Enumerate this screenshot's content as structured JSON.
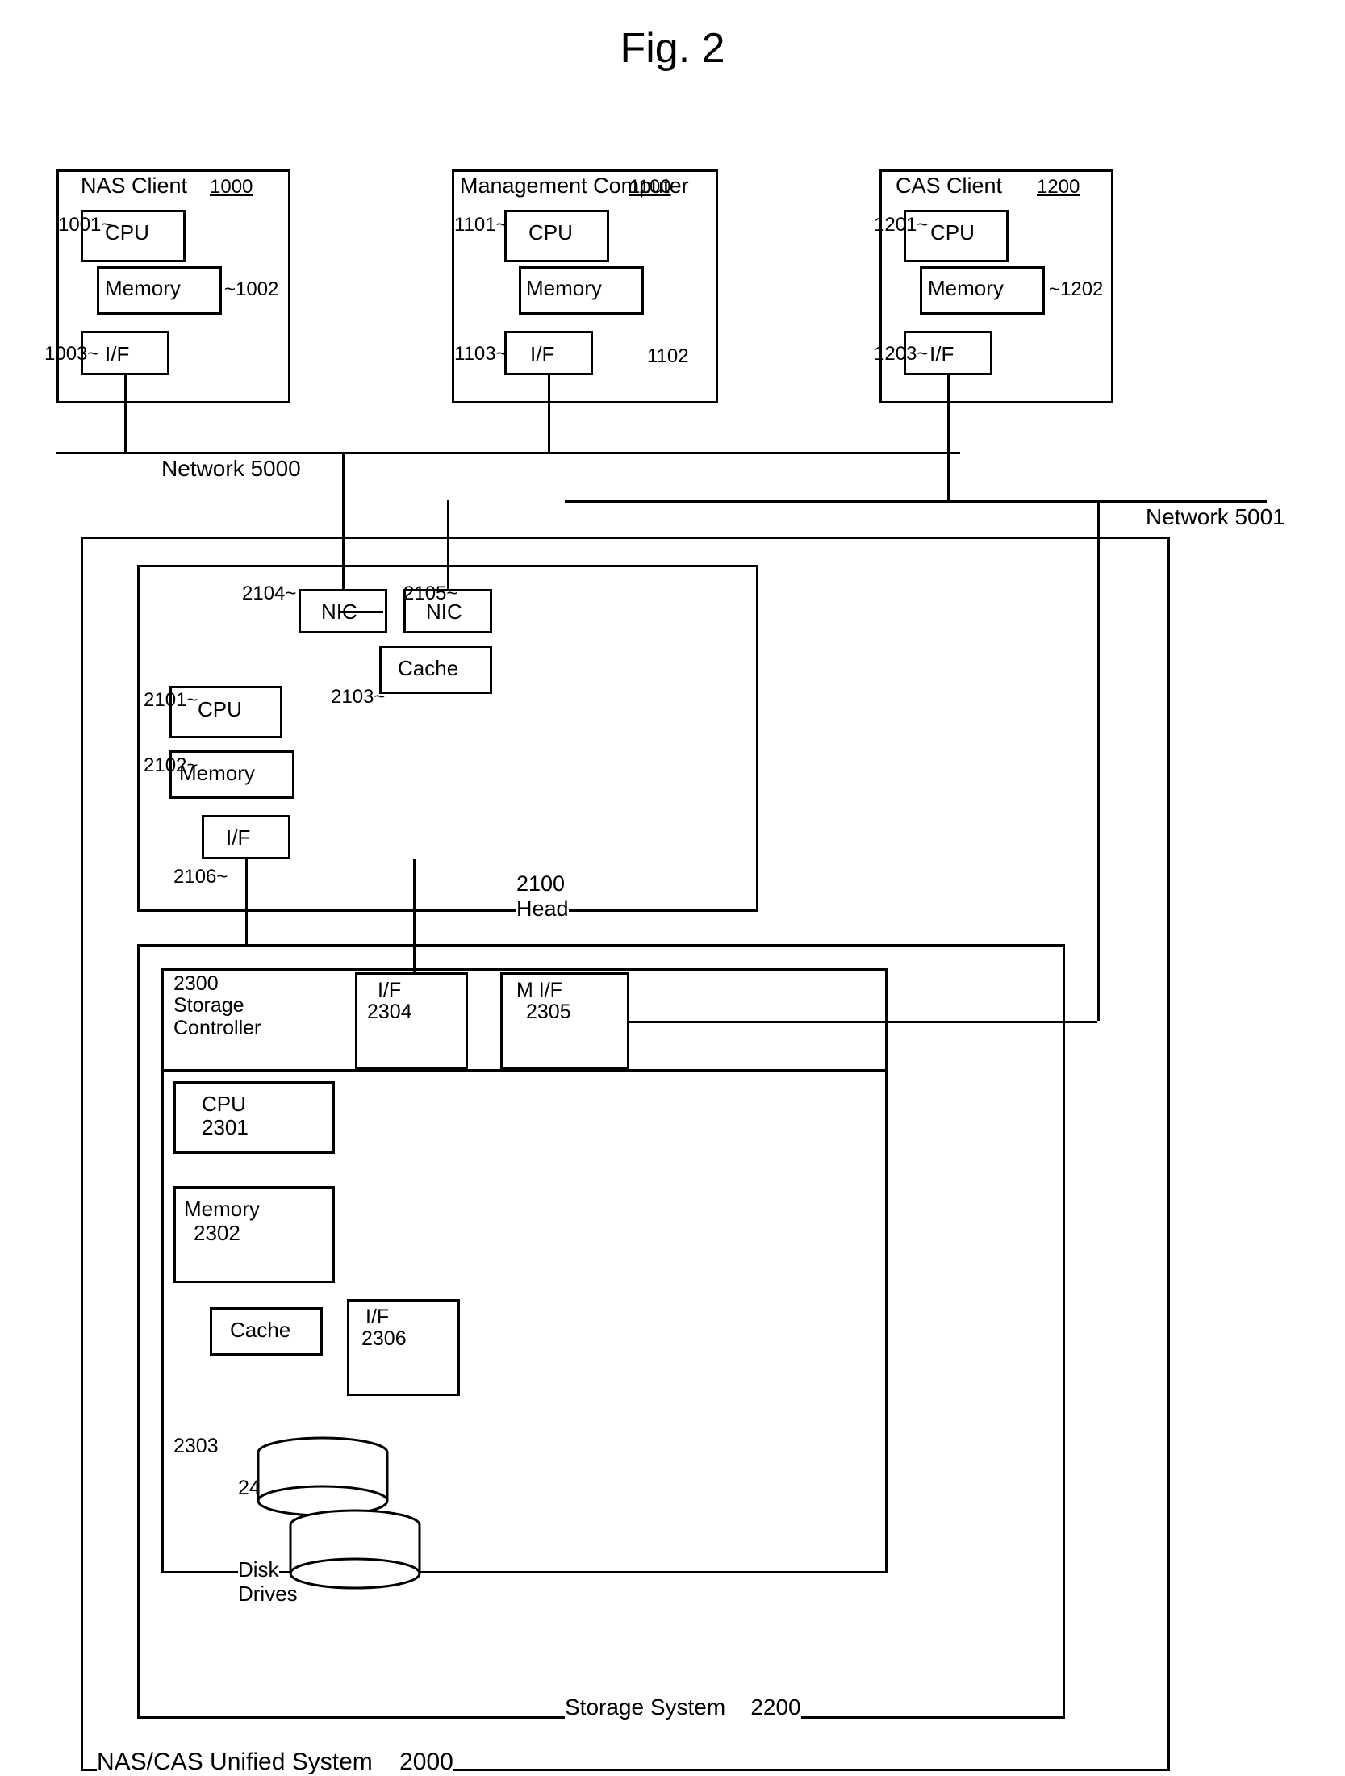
{
  "title": "Fig. 2",
  "nodes": {
    "nas_client": {
      "label": "NAS Client",
      "ref": "1000",
      "cpu_label": "CPU",
      "cpu_ref": "1001",
      "mem_label": "Memory",
      "mem_ref": "1002",
      "if_label": "I/F",
      "if_ref": "1003"
    },
    "mgmt_computer": {
      "label": "Management Computer",
      "ref": "1100",
      "cpu_label": "CPU",
      "cpu_ref": "1101",
      "mem_label": "Memory",
      "mem_ref": "1102",
      "if_label": "I/F",
      "if_ref": "1103"
    },
    "cas_client": {
      "label": "CAS Client",
      "ref": "1200",
      "cpu_label": "CPU",
      "cpu_ref": "1201",
      "mem_label": "Memory",
      "mem_ref": "1202",
      "if_label": "I/F",
      "if_ref": "1203"
    },
    "network5000": {
      "label": "Network 5000"
    },
    "network5001": {
      "label": "Network 5001"
    },
    "head": {
      "label": "Head",
      "ref": "2100",
      "nic1_label": "NIC",
      "nic1_ref": "2104",
      "nic2_label": "NIC",
      "nic2_ref": "2105",
      "cache_label": "Cache",
      "cache_ref": "2103",
      "cpu_label": "CPU",
      "cpu_ref": "2101",
      "mem_label": "Memory",
      "mem_ref": "2102",
      "if_label": "I/F",
      "if_ref": "2106"
    },
    "storage_system": {
      "label": "Storage System",
      "ref": "2200",
      "controller_label": "Storage\nController",
      "controller_ref": "2300",
      "cpu_label": "CPU\n2301",
      "mem_label": "Memory\n2302",
      "cache_label": "Cache",
      "if1_label": "I/F",
      "if1_ref": "2304",
      "if2_label": "M I/F",
      "if2_ref": "2305",
      "if3_label": "I/F",
      "if3_ref": "2306",
      "disk_label": "Disk\nDrives",
      "disk_ref": "2400",
      "disk_ref2": "2303"
    },
    "unified": {
      "label": "NAS/CAS Unified System",
      "ref": "2000"
    }
  }
}
